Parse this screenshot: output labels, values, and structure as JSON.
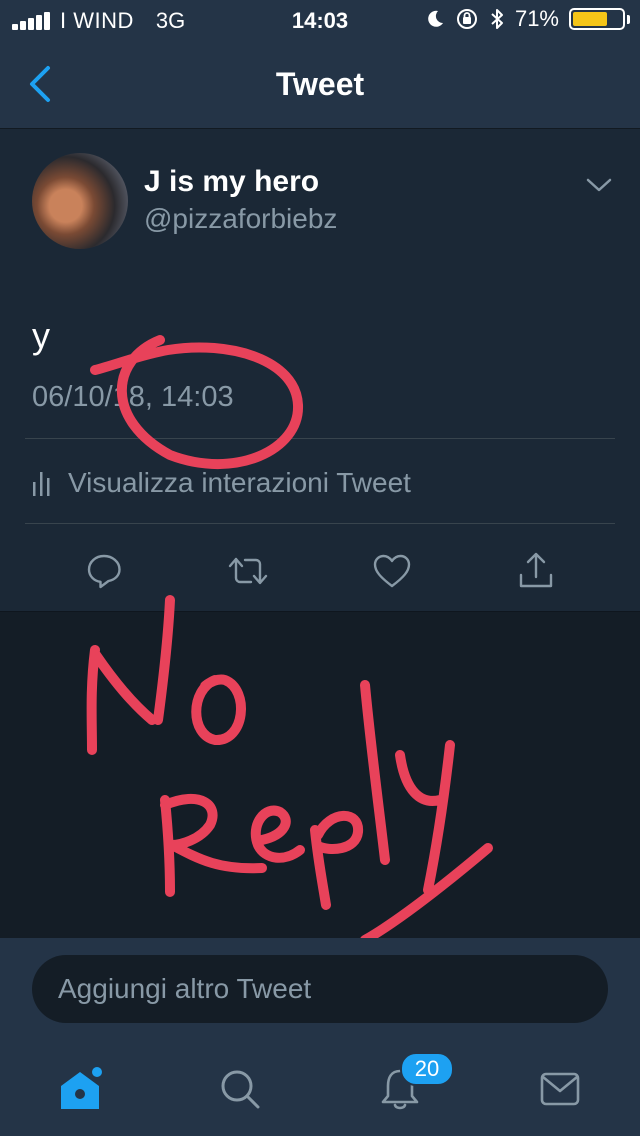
{
  "status_bar": {
    "carrier": "I WIND",
    "network": "3G",
    "time": "14:03",
    "battery_percent_label": "71%",
    "battery_level": 0.71
  },
  "nav": {
    "title": "Tweet",
    "back_icon": "chevron-left-icon"
  },
  "tweet": {
    "display_name": "J is my hero",
    "handle": "@pizzaforbiebz",
    "text": "y",
    "timestamp": "06/10/18, 14:03",
    "analytics_label": "Visualizza interazioni Tweet",
    "actions": [
      "reply-icon",
      "retweet-icon",
      "like-icon",
      "share-icon"
    ]
  },
  "annotation": {
    "handwritten_text": "No Reply",
    "color": "#e8425a"
  },
  "composer": {
    "placeholder": "Aggiungi altro Tweet"
  },
  "tab_bar": {
    "tabs": [
      "home-icon",
      "search-icon",
      "notifications-icon",
      "messages-icon"
    ],
    "notifications_badge": "20"
  },
  "colors": {
    "accent": "#1da1f2",
    "background": "#141d26",
    "card": "#1b2836",
    "bar": "#243447",
    "secondary_text": "#8899a6"
  }
}
